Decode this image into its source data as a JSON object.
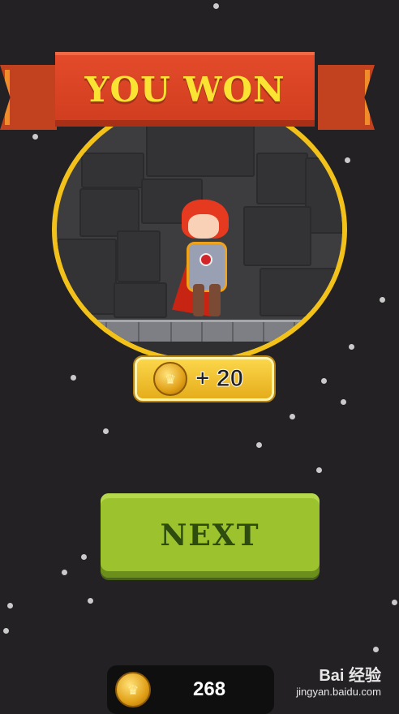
{
  "banner": {
    "title": "YOU WON"
  },
  "reward": {
    "amount_text": "+ 20",
    "coin_icon": "crown-coin-icon"
  },
  "next_button": {
    "label": "NEXT"
  },
  "coin_bar": {
    "value": "268",
    "coin_icon": "crown-coin-icon"
  },
  "watermark": {
    "logo": "Bai 经验",
    "url": "jingyan.baidu.com"
  },
  "colors": {
    "background": "#232124",
    "banner": "#cf3d1f",
    "banner_text": "#fbe334",
    "ring": "#f2c21b",
    "button": "#9cc22e",
    "button_text": "#2f4c10"
  }
}
